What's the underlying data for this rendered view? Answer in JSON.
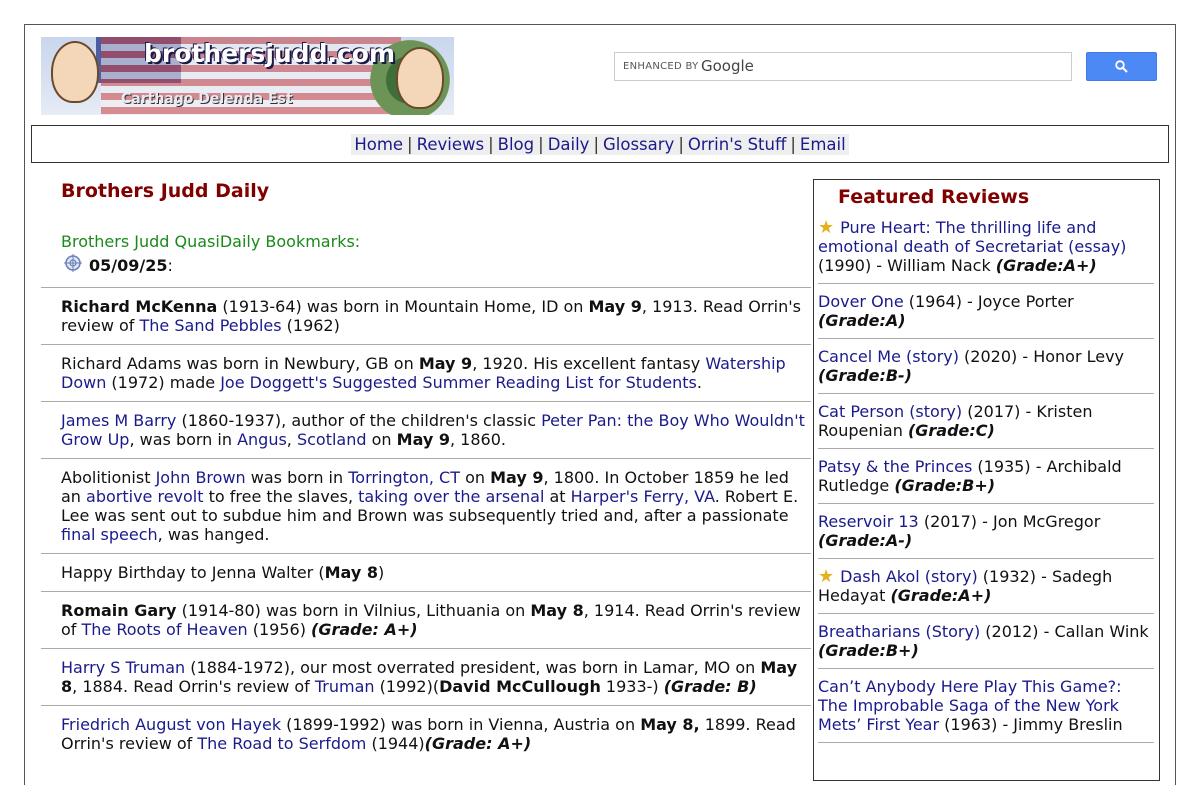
{
  "header": {
    "logo_title": "brothersjudd.com",
    "logo_motto": "Carthago Delenda Est",
    "search": {
      "enhanced_by": "ENHANCED BY",
      "google": "Google",
      "placeholder": "",
      "button_icon": "search-icon"
    }
  },
  "nav": [
    "Home",
    "Reviews",
    "Blog",
    "Daily",
    "Glossary",
    "Orrin's Stuff",
    "Email"
  ],
  "main": {
    "title": "Brothers Judd Daily",
    "subtitle": "Brothers Judd QuasiDaily Bookmarks:",
    "date": "05/09/25",
    "date_suffix": ":",
    "entries": [
      "<b>Richard McKenna</b> (1913-64) was born in Mountain Home, ID on <b>May 9</b>, 1913. Read Orrin's review of <span class='lnk'>The Sand Pebbles</span> (1962)",
      "Richard Adams was born in Newbury, GB on <b>May 9</b>, 1920. His excellent fantasy <span class='lnk'>Watership Down</span> (1972) made <span class='lnk'>Joe Doggett's Suggested Summer Reading List for Students</span>.",
      "<span class='lnk'>James M Barry</span> (1860-1937), author of the children's classic <span class='lnk'>Peter Pan: the Boy Who Wouldn't Grow Up</span>, was born in <span class='lnk'>Angus</span>, <span class='lnk'>Scotland</span> on <b>May 9</b>, 1860.",
      "Abolitionist <span class='lnk'>John Brown</span> was born in <span class='lnk'>Torrington, CT</span> on <b>May 9</b>, 1800. In October 1859 he led an <span class='lnk'>abortive revolt</span> to free the slaves, <span class='lnk'>taking over the arsenal</span> at <span class='lnk'>Harper's Ferry, VA</span>. Robert E. Lee was sent out to subdue him and Brown was subsequently tried and, after a passionate <span class='lnk'>final speech</span>, was hanged.",
      "Happy Birthday to Jenna Walter (<b>May 8</b>)",
      "<b>Romain Gary</b> (1914-80) was born in Vilnius, Lithuania on <b>May 8</b>, 1914. Read Orrin's review of <span class='lnk'>The Roots of Heaven</span> (1956) <b><i>(Grade: A+)</i></b>",
      "<span class='lnk'>Harry S Truman</span> (1884-1972), our most overrated president, was born in Lamar, MO on <b>May 8</b>, 1884. Read Orrin's review of <span class='lnk'>Truman</span> (1992)(<b>David McCullough</b> 1933-) <b><i>(Grade: B)</i></b>",
      "<span class='lnk'>Friedrich August von Hayek</span> (1899-1992) was born in Vienna, Austria on <b>May 8,</b> 1899. Read Orrin's review of <span class='lnk'>The Road to Serfdom</span> (1944)<b><i>(Grade: A+)</i></b>"
    ]
  },
  "sidebar": {
    "title": "Featured Reviews",
    "reviews": [
      {
        "star": true,
        "title": "Pure Heart: The thrilling life and emotional death of Secretariat (essay)",
        "meta": "(1990) - William Nack",
        "grade": "(Grade:A+)"
      },
      {
        "star": false,
        "title": "Dover One",
        "meta": "(1964) - Joyce Porter",
        "grade": "(Grade:A)"
      },
      {
        "star": false,
        "title": "Cancel Me (story)",
        "meta": "(2020) - Honor Levy",
        "grade": "(Grade:B-)"
      },
      {
        "star": false,
        "title": "Cat Person (story)",
        "meta": "(2017) - Kristen Roupenian",
        "grade": "(Grade:C)"
      },
      {
        "star": false,
        "title": "Patsy & the Princes",
        "meta": "(1935) - Archibald Rutledge",
        "grade": "(Grade:B+)"
      },
      {
        "star": false,
        "title": "Reservoir 13",
        "meta": "(2017) - Jon McGregor",
        "grade": "(Grade:A-)"
      },
      {
        "star": true,
        "title": "Dash Akol (story)",
        "meta": "(1932) - Sadegh Hedayat",
        "grade": "(Grade:A+)"
      },
      {
        "star": false,
        "title": "Breatharians (Story)",
        "meta": "(2012) - Callan Wink",
        "grade": "(Grade:B+)"
      },
      {
        "star": false,
        "title": "Can’t Anybody Here Play This Game?: The Improbable Saga of the New York Mets’ First Year",
        "meta": "(1963) - Jimmy Breslin",
        "grade": ""
      }
    ]
  },
  "colors": {
    "heading": "#800000",
    "link": "#1a1a8c",
    "green": "#1a8a1a",
    "star": "#e2b21c",
    "search_button": "#4d89f4"
  }
}
